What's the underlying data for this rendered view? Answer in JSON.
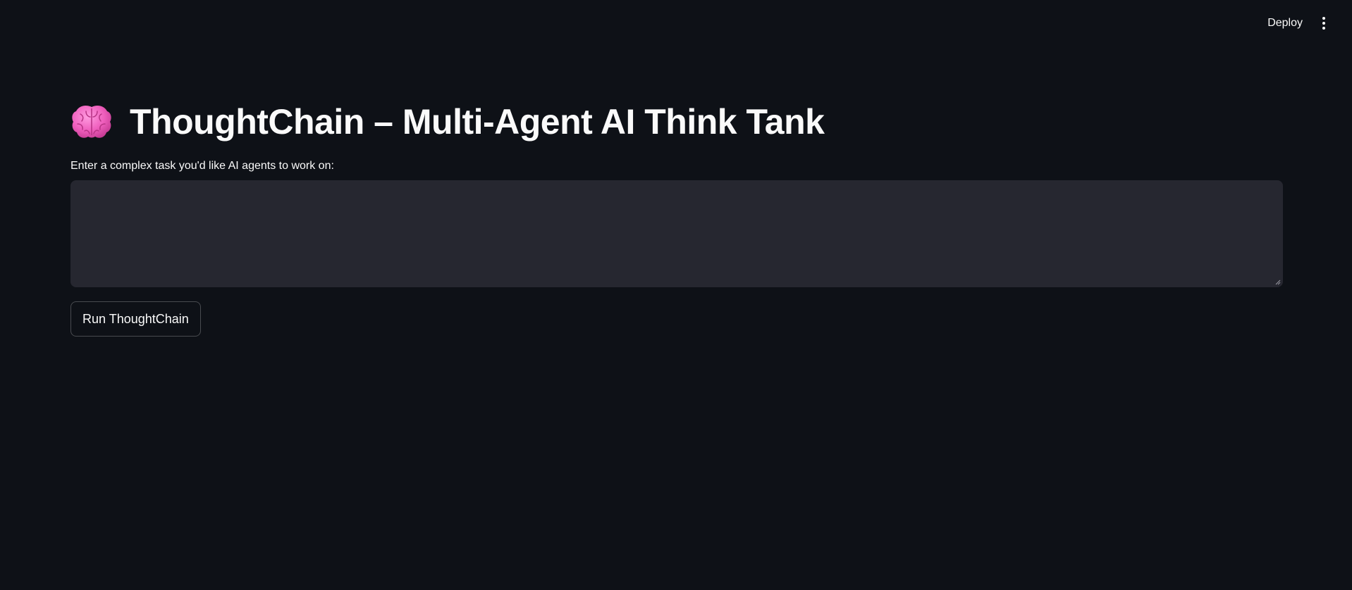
{
  "header": {
    "deploy_label": "Deploy",
    "menu_icon": "more-vertical-icon"
  },
  "main": {
    "title_icon": "brain-icon",
    "title": "ThoughtChain – Multi-Agent AI Think Tank",
    "task_input": {
      "label": "Enter a complex task you'd like AI agents to work on:",
      "value": "",
      "placeholder": ""
    },
    "run_button_label": "Run ThoughtChain"
  },
  "colors": {
    "background": "#0e1117",
    "input_background": "#262730",
    "text": "#fafafa",
    "brain_pink": "#f06fc4"
  }
}
